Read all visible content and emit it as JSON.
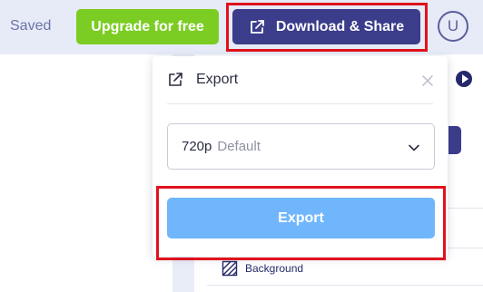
{
  "topbar": {
    "saved_label": "Saved",
    "upgrade_label": "Upgrade for free",
    "download_label": "Download & Share",
    "download_icon": "external-link-icon",
    "avatar_initial": "U"
  },
  "export_panel": {
    "title": "Export",
    "header_icon": "external-link-icon",
    "close_icon": "close-icon",
    "resolution": {
      "value": "720p",
      "hint": "Default",
      "chevron_icon": "chevron-down-icon"
    },
    "export_button_label": "Export"
  },
  "side_panel": {
    "layer_label": "Background",
    "layer_icon": "background-pattern-icon",
    "arrow_icon": "play-arrow-icon"
  },
  "colors": {
    "topbar_bg": "#e6ebf7",
    "upgrade_green": "#7ccd23",
    "primary_navy": "#3b3d8b",
    "export_blue": "#70b6fc",
    "highlight_red": "#e0121d"
  }
}
